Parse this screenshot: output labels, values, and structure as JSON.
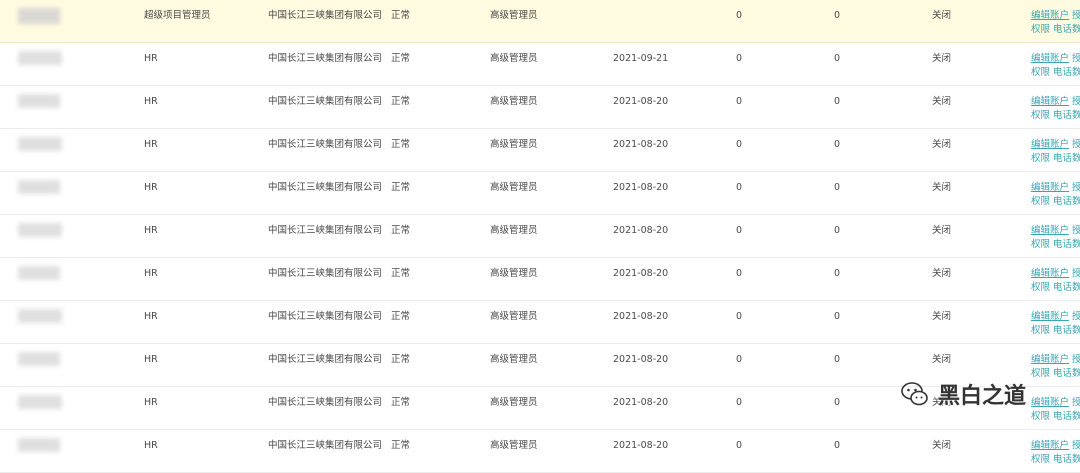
{
  "rows": [
    {
      "role": "超级项目管理员",
      "company": "中国长江三峡集团有限公司",
      "status": "正常",
      "level": "高级管理员",
      "date": "",
      "n1": "0",
      "n2": "0",
      "closed": "关闭",
      "edit": "编辑账户",
      "more": "授",
      "perm": "权限",
      "phone": "电话数"
    },
    {
      "role": "HR",
      "company": "中国长江三峡集团有限公司",
      "status": "正常",
      "level": "高级管理员",
      "date": "2021-09-21",
      "n1": "0",
      "n2": "0",
      "closed": "关闭",
      "edit": "编辑账户",
      "more": "授",
      "perm": "权限",
      "phone": "电话数"
    },
    {
      "role": "HR",
      "company": "中国长江三峡集团有限公司",
      "status": "正常",
      "level": "高级管理员",
      "date": "2021-08-20",
      "n1": "0",
      "n2": "0",
      "closed": "关闭",
      "edit": "编辑账户",
      "more": "授",
      "perm": "权限",
      "phone": "电话数"
    },
    {
      "role": "HR",
      "company": "中国长江三峡集团有限公司",
      "status": "正常",
      "level": "高级管理员",
      "date": "2021-08-20",
      "n1": "0",
      "n2": "0",
      "closed": "关闭",
      "edit": "编辑账户",
      "more": "授",
      "perm": "权限",
      "phone": "电话数"
    },
    {
      "role": "HR",
      "company": "中国长江三峡集团有限公司",
      "status": "正常",
      "level": "高级管理员",
      "date": "2021-08-20",
      "n1": "0",
      "n2": "0",
      "closed": "关闭",
      "edit": "编辑账户",
      "more": "授",
      "perm": "权限",
      "phone": "电话数"
    },
    {
      "role": "HR",
      "company": "中国长江三峡集团有限公司",
      "status": "正常",
      "level": "高级管理员",
      "date": "2021-08-20",
      "n1": "0",
      "n2": "0",
      "closed": "关闭",
      "edit": "编辑账户",
      "more": "授",
      "perm": "权限",
      "phone": "电话数"
    },
    {
      "role": "HR",
      "company": "中国长江三峡集团有限公司",
      "status": "正常",
      "level": "高级管理员",
      "date": "2021-08-20",
      "n1": "0",
      "n2": "0",
      "closed": "关闭",
      "edit": "编辑账户",
      "more": "授",
      "perm": "权限",
      "phone": "电话数"
    },
    {
      "role": "HR",
      "company": "中国长江三峡集团有限公司",
      "status": "正常",
      "level": "高级管理员",
      "date": "2021-08-20",
      "n1": "0",
      "n2": "0",
      "closed": "关闭",
      "edit": "编辑账户",
      "more": "授",
      "perm": "权限",
      "phone": "电话数"
    },
    {
      "role": "HR",
      "company": "中国长江三峡集团有限公司",
      "status": "正常",
      "level": "高级管理员",
      "date": "2021-08-20",
      "n1": "0",
      "n2": "0",
      "closed": "关闭",
      "edit": "编辑账户",
      "more": "授",
      "perm": "权限",
      "phone": "电话数"
    },
    {
      "role": "HR",
      "company": "中国长江三峡集团有限公司",
      "status": "正常",
      "level": "高级管理员",
      "date": "2021-08-20",
      "n1": "0",
      "n2": "0",
      "closed": "关闭",
      "edit": "编辑账户",
      "more": "授",
      "perm": "权限",
      "phone": "电话数"
    },
    {
      "role": "HR",
      "company": "中国长江三峡集团有限公司",
      "status": "正常",
      "level": "高级管理员",
      "date": "2021-08-20",
      "n1": "0",
      "n2": "0",
      "closed": "关闭",
      "edit": "编辑账户",
      "more": "授",
      "perm": "权限",
      "phone": "电话数"
    }
  ],
  "watermark": {
    "text": "黑白之道",
    "icon": "wechat-icon"
  },
  "colors": {
    "highlight_row": "#fffbe0",
    "link": "#3aa6b0",
    "text": "#4a4a4a",
    "divider": "#ececec"
  }
}
